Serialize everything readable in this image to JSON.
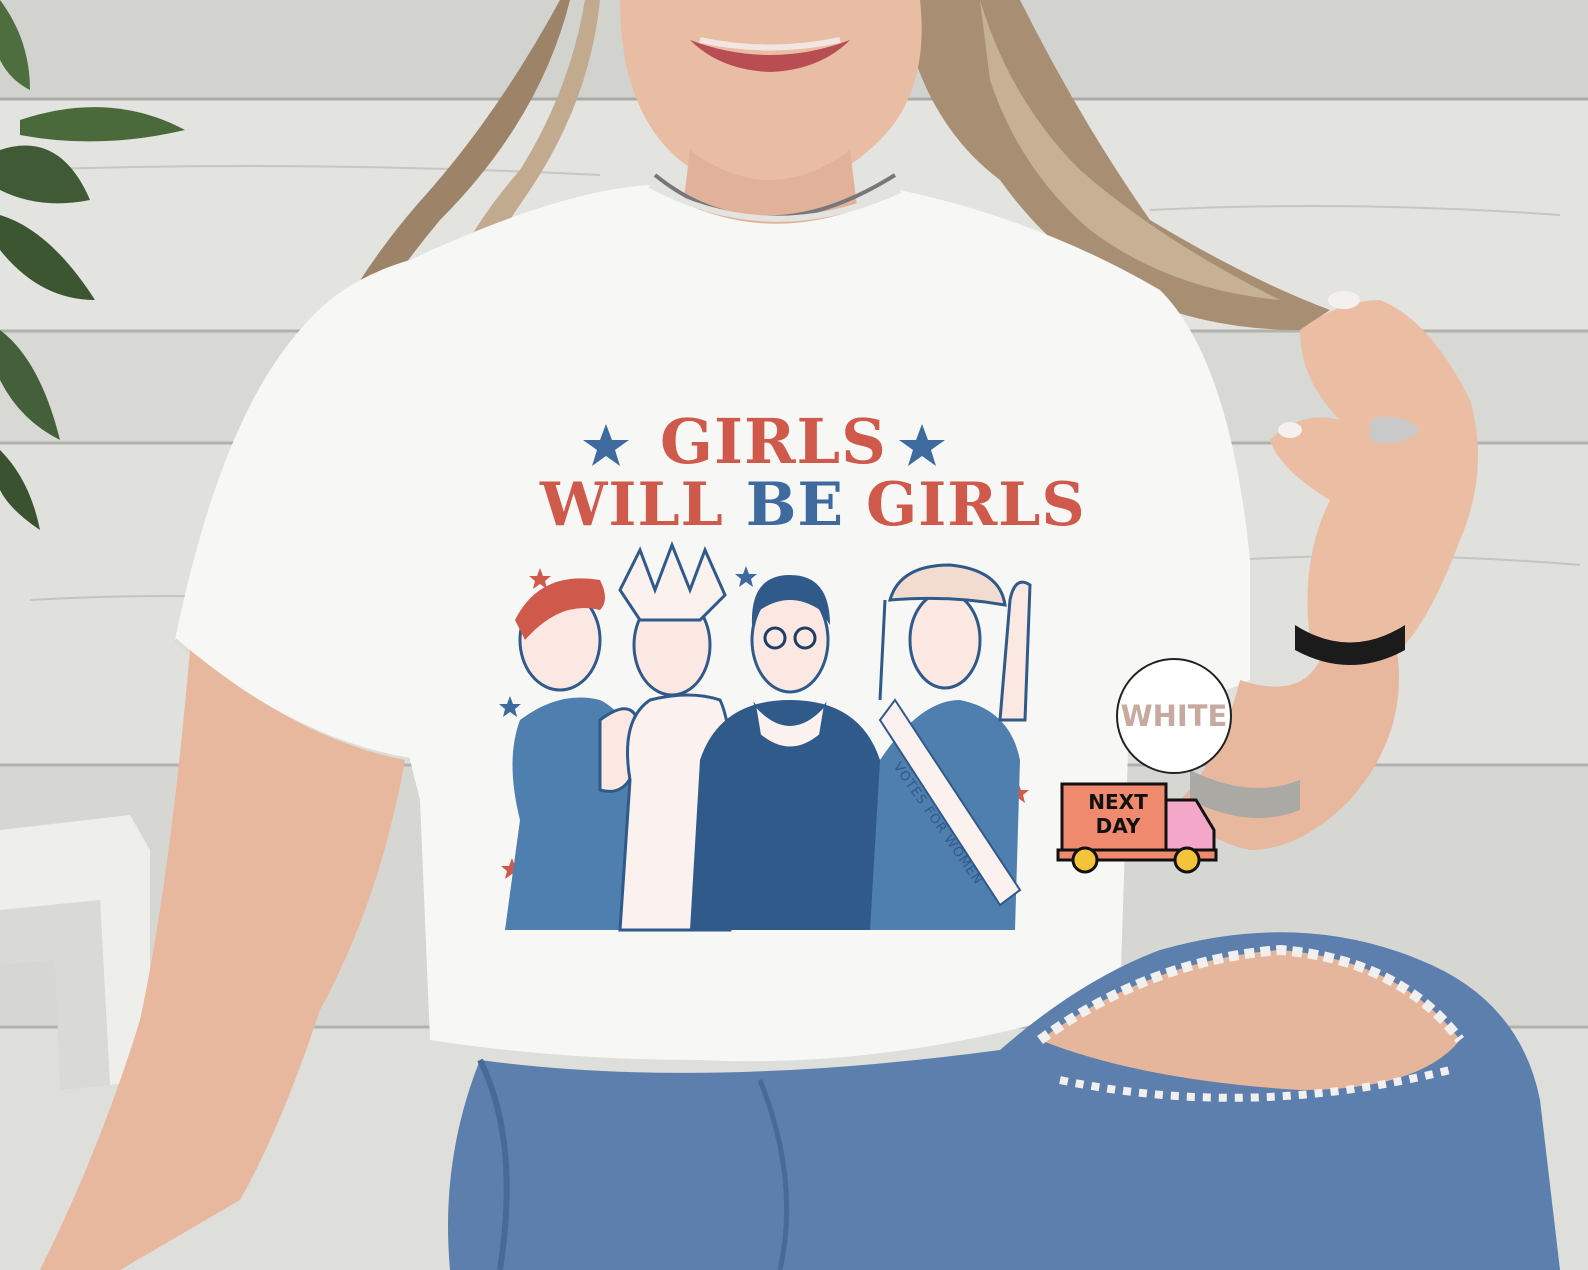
{
  "shirt_graphic": {
    "title_line1": "GIRLS",
    "title_line2_part1": "WILL ",
    "title_line2_part2": "BE",
    "title_line2_part3": " GIRLS",
    "sash_text": "VOTES FOR WOMEN"
  },
  "color_badge": {
    "label": "WHITE"
  },
  "delivery_badge": {
    "line1": "NEXT",
    "line2": "DAY"
  },
  "colors": {
    "shirt": "#f7f7f6",
    "title_red": "#cf5a4c",
    "title_blue": "#3e6a9e",
    "illustration_blue": "#4f7fae",
    "truck_body": "#f08a6e",
    "truck_cab": "#f4a7c9",
    "wheel": "#f4c33a",
    "wood_background": "#dcdcd8",
    "denim": "#5d7fae"
  }
}
